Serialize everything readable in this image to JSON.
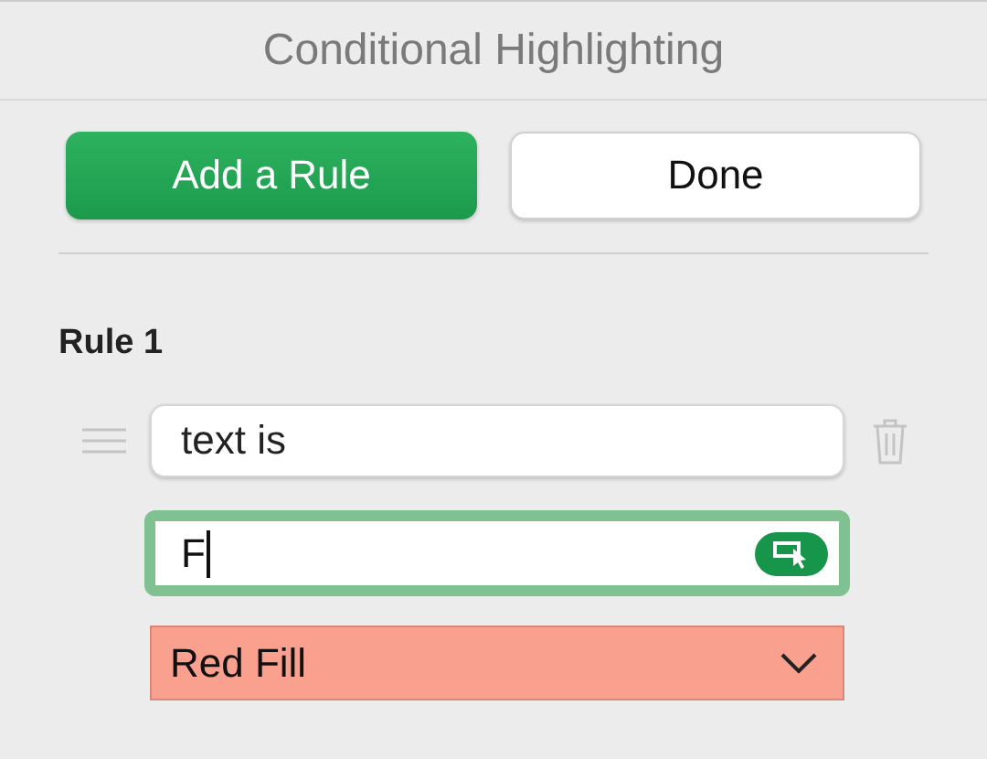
{
  "panel": {
    "title": "Conditional Highlighting"
  },
  "buttons": [
    {
      "label": "Add a Rule",
      "kind": "primary"
    },
    {
      "label": "Done",
      "kind": "secondary"
    }
  ],
  "rules": [
    {
      "title": "Rule 1",
      "condition": "text is",
      "value": "F",
      "focused": true,
      "style": {
        "label": "Red Fill",
        "color": "#f9a08f"
      }
    }
  ]
}
